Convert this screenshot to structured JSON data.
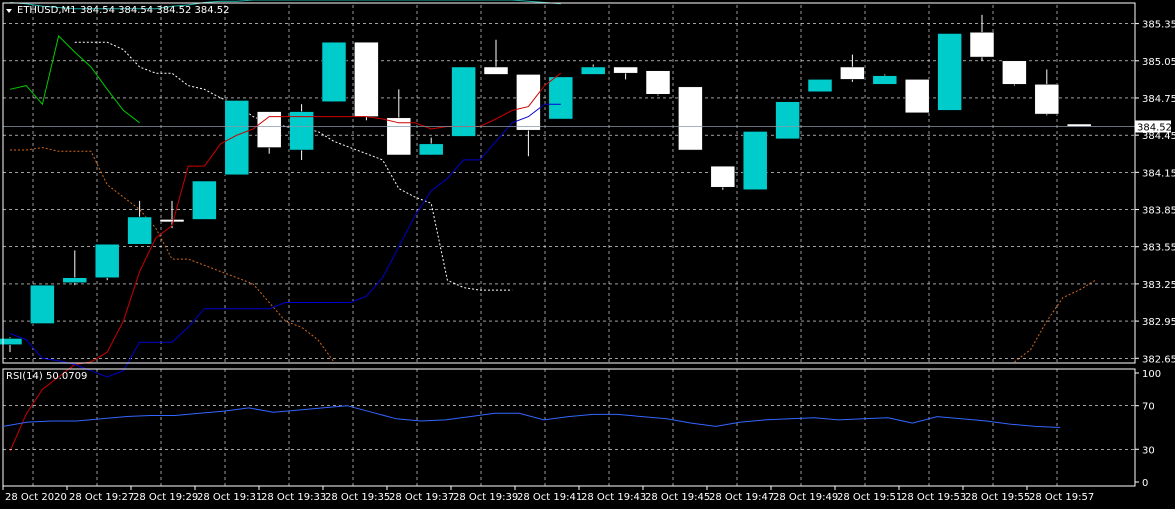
{
  "header": {
    "symbol": "ETHUSD,M1",
    "ohlc": "384.54 384.54 384.52 384.52"
  },
  "current_price_label": "384.52",
  "colors": {
    "background": "#000000",
    "grid": "#ffffff",
    "bull": "#00cccc",
    "bear": "#ffffff",
    "tenkan": "#cc0000",
    "kijun": "#0000cc",
    "chikou": "#00cc00",
    "senkou_a": "#d2691e",
    "senkou_b": "#ffffff",
    "top_line": "#20b2aa",
    "rsi": "#3366ff"
  },
  "chart_data": [
    {
      "type": "candlestick",
      "title": "ETHUSD,M1",
      "x": [
        "28 Oct 2020",
        "28 Oct 19:27",
        "28 Oct 19:29",
        "28 Oct 19:31",
        "28 Oct 19:33",
        "28 Oct 19:35",
        "28 Oct 19:37",
        "28 Oct 19:39",
        "28 Oct 19:41",
        "28 Oct 19:43",
        "28 Oct 19:45",
        "28 Oct 19:47",
        "28 Oct 19:49",
        "28 Oct 19:51",
        "28 Oct 19:53",
        "28 Oct 19:55",
        "28 Oct 19:57"
      ],
      "x_tick_labels": [
        "28 Oct 2020",
        "28 Oct 19:27",
        "28 Oct 19:29",
        "28 Oct 19:31",
        "28 Oct 19:33",
        "28 Oct 19:35",
        "28 Oct 19:37",
        "28 Oct 19:39",
        "28 Oct 19:41",
        "28 Oct 19:43",
        "28 Oct 19:45",
        "28 Oct 19:47",
        "28 Oct 19:49",
        "28 Oct 19:51",
        "28 Oct 19:53",
        "28 Oct 19:55",
        "28 Oct 19:57"
      ],
      "y_ticks": [
        385.35,
        385.05,
        384.75,
        384.45,
        384.15,
        383.85,
        383.55,
        383.25,
        382.95,
        382.65
      ],
      "y_tick_labels": [
        "385.35",
        "385.05",
        "384.75",
        "384.45",
        "384.15",
        "383.85",
        "383.55",
        "383.25",
        "382.95",
        "382.65"
      ],
      "ylim": [
        382.62,
        385.5
      ],
      "grid": true,
      "candles": [
        {
          "o": 382.76,
          "h": 382.82,
          "l": 382.7,
          "c": 382.81
        },
        {
          "o": 382.93,
          "h": 383.24,
          "l": 382.93,
          "c": 383.24
        },
        {
          "o": 383.26,
          "h": 383.52,
          "l": 383.24,
          "c": 383.3
        },
        {
          "o": 383.3,
          "h": 383.55,
          "l": 383.28,
          "c": 383.57
        },
        {
          "o": 383.57,
          "h": 383.92,
          "l": 383.57,
          "c": 383.79
        },
        {
          "o": 383.77,
          "h": 383.92,
          "l": 383.7,
          "c": 383.75
        },
        {
          "o": 383.77,
          "h": 384.06,
          "l": 383.77,
          "c": 384.08
        },
        {
          "o": 384.13,
          "h": 384.73,
          "l": 384.13,
          "c": 384.73
        },
        {
          "o": 384.64,
          "h": 384.64,
          "l": 384.3,
          "c": 384.35
        },
        {
          "o": 384.33,
          "h": 384.7,
          "l": 384.25,
          "c": 384.64
        },
        {
          "o": 384.72,
          "h": 385.2,
          "l": 384.72,
          "c": 385.2
        },
        {
          "o": 385.2,
          "h": 385.2,
          "l": 384.57,
          "c": 384.6
        },
        {
          "o": 384.59,
          "h": 384.82,
          "l": 384.3,
          "c": 384.29
        },
        {
          "o": 384.29,
          "h": 384.43,
          "l": 384.29,
          "c": 384.38
        },
        {
          "o": 384.44,
          "h": 385.0,
          "l": 384.44,
          "c": 385.0
        },
        {
          "o": 385.0,
          "h": 385.22,
          "l": 384.95,
          "c": 384.94
        },
        {
          "o": 384.94,
          "h": 384.94,
          "l": 384.28,
          "c": 384.49
        },
        {
          "o": 384.58,
          "h": 384.92,
          "l": 384.58,
          "c": 384.92
        },
        {
          "o": 384.94,
          "h": 385.02,
          "l": 384.94,
          "c": 385.0
        },
        {
          "o": 385.0,
          "h": 385.0,
          "l": 384.9,
          "c": 384.95
        },
        {
          "o": 384.97,
          "h": 384.97,
          "l": 384.77,
          "c": 384.78
        },
        {
          "o": 384.84,
          "h": 384.84,
          "l": 384.33,
          "c": 384.33
        },
        {
          "o": 384.2,
          "h": 384.2,
          "l": 384.01,
          "c": 384.03
        },
        {
          "o": 384.01,
          "h": 384.48,
          "l": 384.01,
          "c": 384.48
        },
        {
          "o": 384.42,
          "h": 384.72,
          "l": 384.42,
          "c": 384.72
        },
        {
          "o": 384.8,
          "h": 384.88,
          "l": 384.8,
          "c": 384.9
        },
        {
          "o": 385.0,
          "h": 385.1,
          "l": 384.88,
          "c": 384.9
        },
        {
          "o": 384.86,
          "h": 384.94,
          "l": 384.86,
          "c": 384.93
        },
        {
          "o": 384.9,
          "h": 384.9,
          "l": 384.63,
          "c": 384.63
        },
        {
          "o": 384.65,
          "h": 385.27,
          "l": 384.65,
          "c": 385.27
        },
        {
          "o": 385.28,
          "h": 385.42,
          "l": 385.05,
          "c": 385.08
        },
        {
          "o": 385.05,
          "h": 385.05,
          "l": 384.85,
          "c": 384.86
        },
        {
          "o": 384.86,
          "h": 384.98,
          "l": 384.61,
          "c": 384.62
        },
        {
          "o": 384.54,
          "h": 384.54,
          "l": 384.52,
          "c": 384.52
        }
      ],
      "lines": {
        "tenkan": [
          381.9,
          382.2,
          382.4,
          382.5,
          382.6,
          382.62,
          382.7,
          382.95,
          383.35,
          383.62,
          383.72,
          384.2,
          384.2,
          384.38,
          384.45,
          384.5,
          384.6,
          384.6,
          384.6,
          384.6,
          384.6,
          384.6,
          384.6,
          384.58,
          384.55,
          384.55,
          384.5,
          384.52,
          384.52,
          384.52,
          384.58,
          384.65,
          384.68,
          384.85,
          384.95
        ],
        "kijun": [
          382.85,
          382.8,
          382.65,
          382.63,
          382.6,
          382.55,
          382.5,
          382.55,
          382.78,
          382.78,
          382.78,
          382.9,
          383.05,
          383.05,
          383.05,
          383.05,
          383.05,
          383.1,
          383.1,
          383.1,
          383.1,
          383.1,
          383.15,
          383.3,
          383.55,
          383.8,
          384.0,
          384.1,
          384.25,
          384.25,
          384.4,
          384.55,
          384.6,
          384.7,
          384.7
        ],
        "chikou": [
          384.82,
          384.85,
          384.7,
          385.25,
          385.12,
          385.0,
          384.82,
          384.65,
          384.55
        ],
        "senkou_a": [
          384.33,
          384.33,
          384.35,
          384.32,
          384.32,
          384.32,
          384.05,
          383.95,
          383.85,
          383.7,
          383.45,
          383.45,
          383.4,
          383.35,
          383.3,
          383.25,
          383.1,
          382.95,
          382.9,
          382.8,
          382.62
        ],
        "senkou_a_tail": [
          382.62,
          382.72,
          382.95,
          383.14,
          383.2,
          383.28
        ],
        "senkou_b": [
          385.2,
          385.2,
          385.2,
          385.14,
          385.0,
          384.95,
          384.95,
          384.85,
          384.82,
          384.75,
          384.7,
          384.6,
          384.55,
          384.52,
          384.5,
          384.48,
          384.4,
          384.35,
          384.3,
          384.25,
          384.02,
          383.95,
          383.9,
          383.28,
          383.22,
          383.2,
          383.2,
          383.2
        ],
        "top_line": [
          385.52,
          385.51,
          385.49,
          385.48,
          385.47,
          385.47,
          385.47,
          385.47,
          385.47,
          385.47,
          385.49,
          385.5,
          385.52,
          385.53,
          385.53,
          385.54,
          385.54,
          385.54,
          385.54,
          385.54,
          385.54,
          385.54,
          385.54,
          385.54,
          385.54,
          385.54,
          385.54,
          385.54,
          385.54,
          385.54,
          385.54,
          385.54,
          385.53,
          385.52,
          385.51
        ]
      },
      "current_price": 384.52
    },
    {
      "type": "line",
      "title": "RSI(14) 50.0709",
      "y_ticks": [
        100,
        70,
        30,
        0
      ],
      "y_tick_labels": [
        "100",
        "70",
        "30",
        "0"
      ],
      "ylim": [
        0,
        100
      ],
      "series": [
        {
          "values": [
            51,
            55,
            56,
            56,
            58,
            60,
            61,
            61,
            63,
            65,
            68,
            64,
            66,
            68,
            70,
            64,
            58,
            56,
            57,
            60,
            63,
            63,
            57,
            60,
            62,
            62,
            60,
            58,
            54,
            51,
            55,
            57,
            58,
            59,
            57,
            58,
            59,
            54,
            60,
            58,
            56,
            53,
            51,
            50
          ]
        }
      ]
    }
  ]
}
